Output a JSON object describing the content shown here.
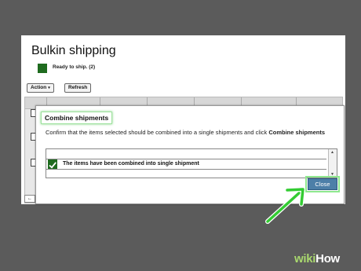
{
  "page": {
    "title": "Bulkin shipping",
    "status_label": "Ready to ship. (2)",
    "toolbar": {
      "action_label": "Action",
      "action_caret": "▾",
      "refresh_label": "Refresh"
    },
    "pager_icon": "←"
  },
  "dialog": {
    "title": "Combine shipments",
    "message_prefix": "Confirm that the items selected should be combined into a single shipments and click ",
    "message_strong": "Combine shipments",
    "result_text": "The items have been combined into single shipment",
    "close_label": "Close",
    "scroll_up_icon": "▲",
    "scroll_down_icon": "▼"
  },
  "watermark": {
    "wiki": "wiki",
    "how": "How"
  },
  "colors": {
    "status_green": "#1f6b1f",
    "highlight_green": "#8fe88f",
    "arrow_green": "#33cc33",
    "close_blue": "#4d7fa8"
  }
}
